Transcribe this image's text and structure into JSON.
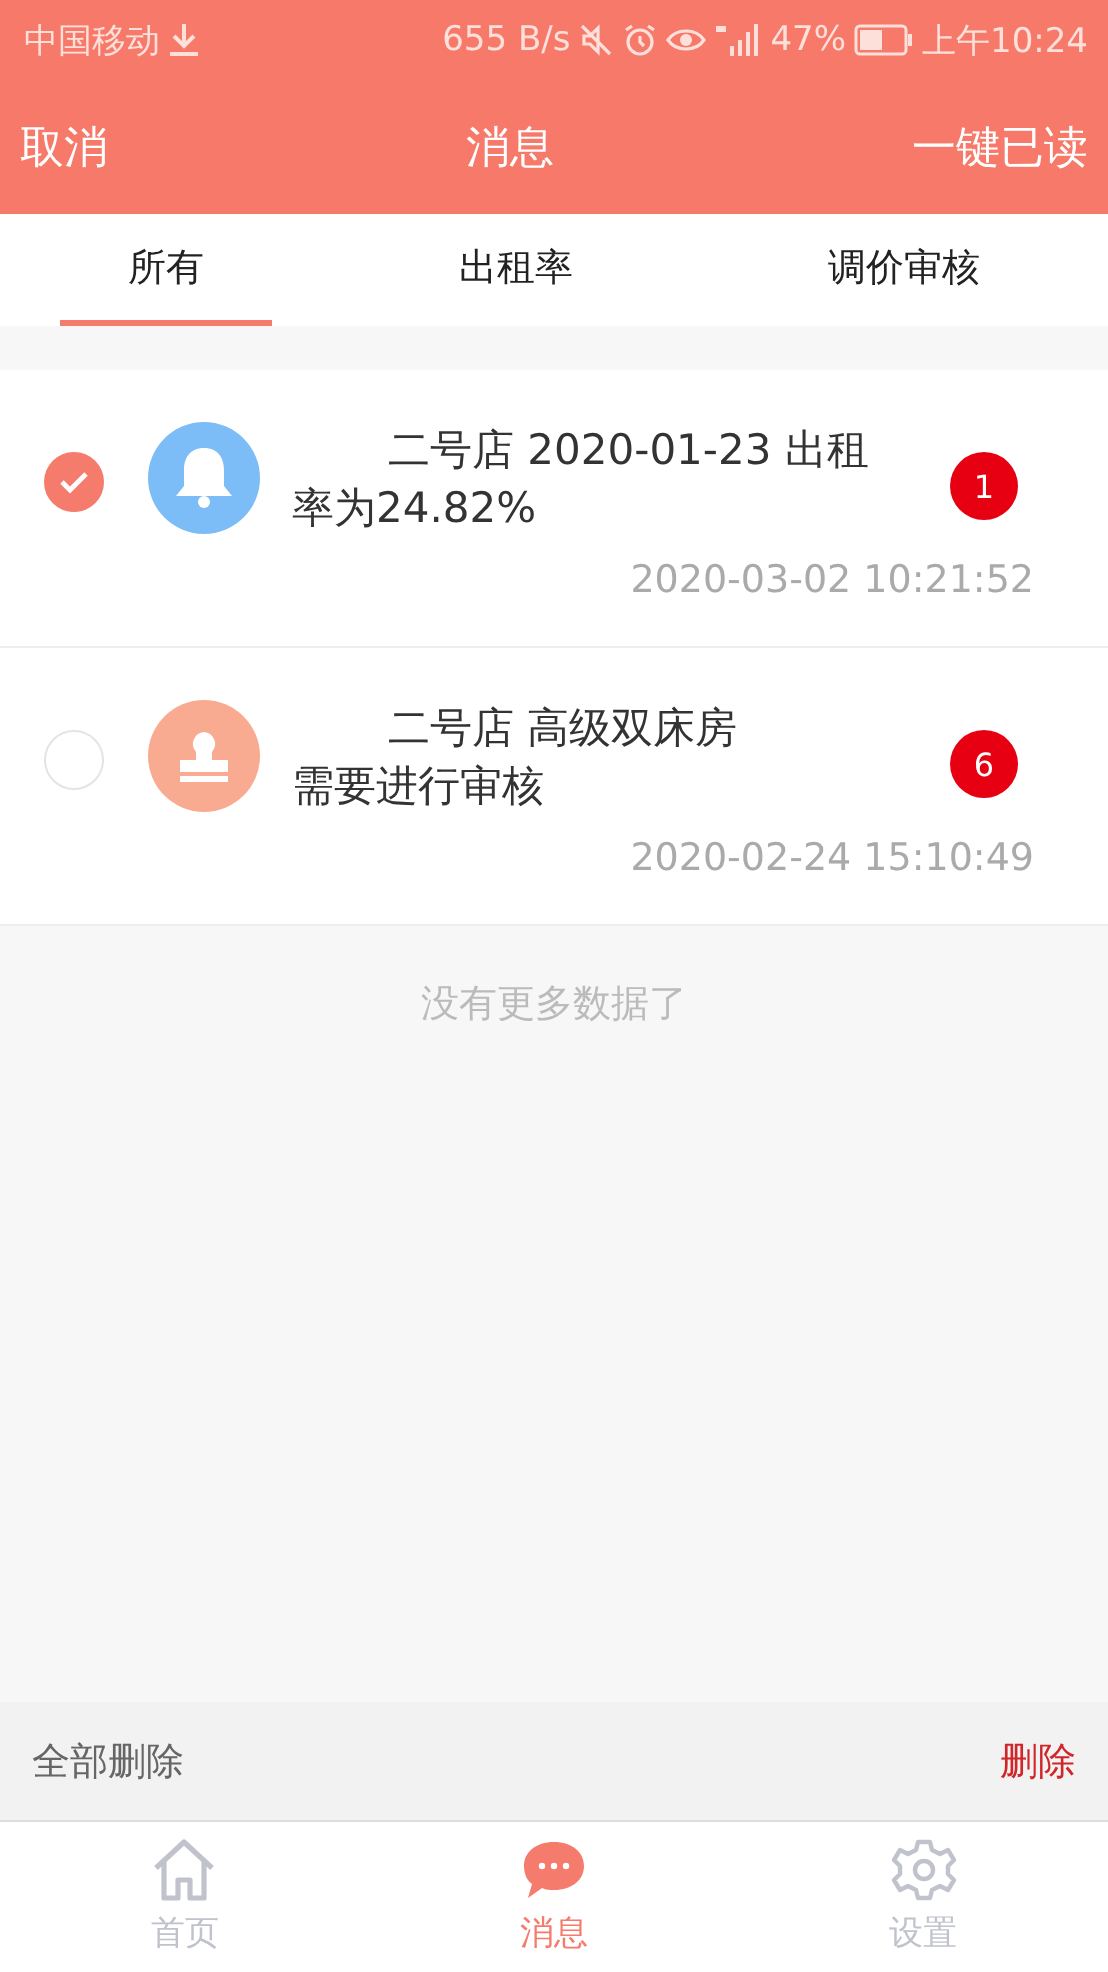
{
  "status_bar": {
    "carrier": "中国移动",
    "speed": "655 B/s",
    "battery": "47%",
    "time": "上午10:24"
  },
  "header": {
    "left": "取消",
    "title": "消息",
    "right": "一键已读"
  },
  "tabs": [
    {
      "label": "所有",
      "selected": true
    },
    {
      "label": "出租率",
      "selected": false
    },
    {
      "label": "调价审核",
      "selected": false
    }
  ],
  "messages": [
    {
      "kind": "notice",
      "checked": true,
      "lines": [
        "二号店 2020-01-23 出租",
        "率为24.82%"
      ],
      "badge": "1",
      "time": "2020-03-02 10:21:52"
    },
    {
      "kind": "review",
      "checked": false,
      "lines": [
        "二号店 高级双床房",
        "需要进行审核"
      ],
      "badge": "6",
      "time": "2020-02-24 15:10:49"
    }
  ],
  "end_note": "没有更多数据了",
  "action_bar": {
    "left": "全部删除",
    "right": "删除"
  },
  "bottom_nav": [
    {
      "kind": "home",
      "label": "首页",
      "selected": false
    },
    {
      "kind": "message",
      "label": "消息",
      "selected": true
    },
    {
      "kind": "settings",
      "label": "设置",
      "selected": false
    }
  ]
}
